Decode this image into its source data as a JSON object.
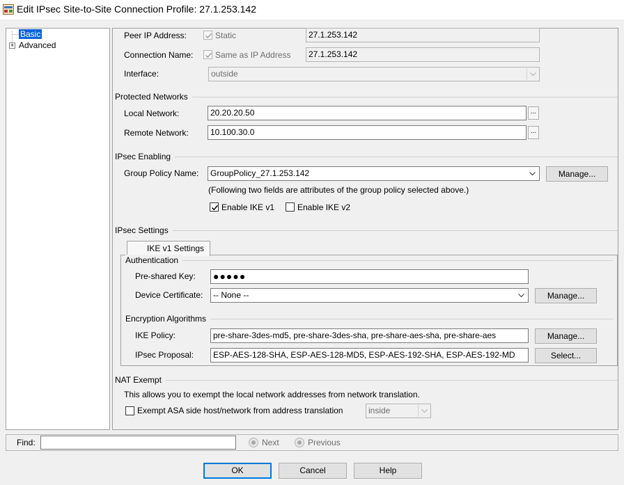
{
  "window": {
    "title": "Edit IPsec Site-to-Site Connection Profile: 27.1.253.142"
  },
  "tree": {
    "items": [
      {
        "label": "Basic"
      },
      {
        "label": "Advanced"
      }
    ]
  },
  "peer": {
    "label": "Peer IP Address:",
    "checkbox_label": "Static",
    "value": "27.1.253.142"
  },
  "connection_name": {
    "label": "Connection Name:",
    "checkbox_label": "Same as IP Address",
    "value": "27.1.253.142"
  },
  "interface": {
    "label": "Interface:",
    "value": "outside"
  },
  "protected_networks": {
    "title": "Protected Networks",
    "local_label": "Local Network:",
    "local_value": "20.20.20.50",
    "remote_label": "Remote Network:",
    "remote_value": "10.100.30.0",
    "browse": "..."
  },
  "ipsec_enabling": {
    "title": "IPsec Enabling",
    "group_policy_label": "Group Policy Name:",
    "group_policy_value": "GroupPolicy_27.1.253.142",
    "manage": "Manage...",
    "note": "(Following two fields are attributes of the group policy selected above.)",
    "ike_v1": "Enable IKE v1",
    "ike_v2": "Enable IKE v2"
  },
  "ipsec_settings": {
    "title": "IPsec Settings",
    "tab": "IKE v1 Settings",
    "auth_title": "Authentication",
    "psk_label": "Pre-shared Key:",
    "psk_value": "●●●●●",
    "cert_label": "Device Certificate:",
    "cert_value": "-- None --",
    "cert_manage": "Manage...",
    "enc_title": "Encryption Algorithms",
    "ike_policy_label": "IKE Policy:",
    "ike_policy_value": "pre-share-3des-md5, pre-share-3des-sha, pre-share-aes-sha, pre-share-aes",
    "ike_manage": "Manage...",
    "proposal_label": "IPsec Proposal:",
    "proposal_value": "ESP-AES-128-SHA, ESP-AES-128-MD5, ESP-AES-192-SHA, ESP-AES-192-MD",
    "select": "Select..."
  },
  "nat": {
    "title": "NAT Exempt",
    "desc": "This allows you to exempt the local network addresses from network translation.",
    "checkbox_label": "Exempt ASA side host/network from address translation",
    "iface_value": "inside"
  },
  "find": {
    "label": "Find:",
    "value": "",
    "next": "Next",
    "previous": "Previous"
  },
  "buttons": {
    "ok": "OK",
    "cancel": "Cancel",
    "help": "Help"
  }
}
